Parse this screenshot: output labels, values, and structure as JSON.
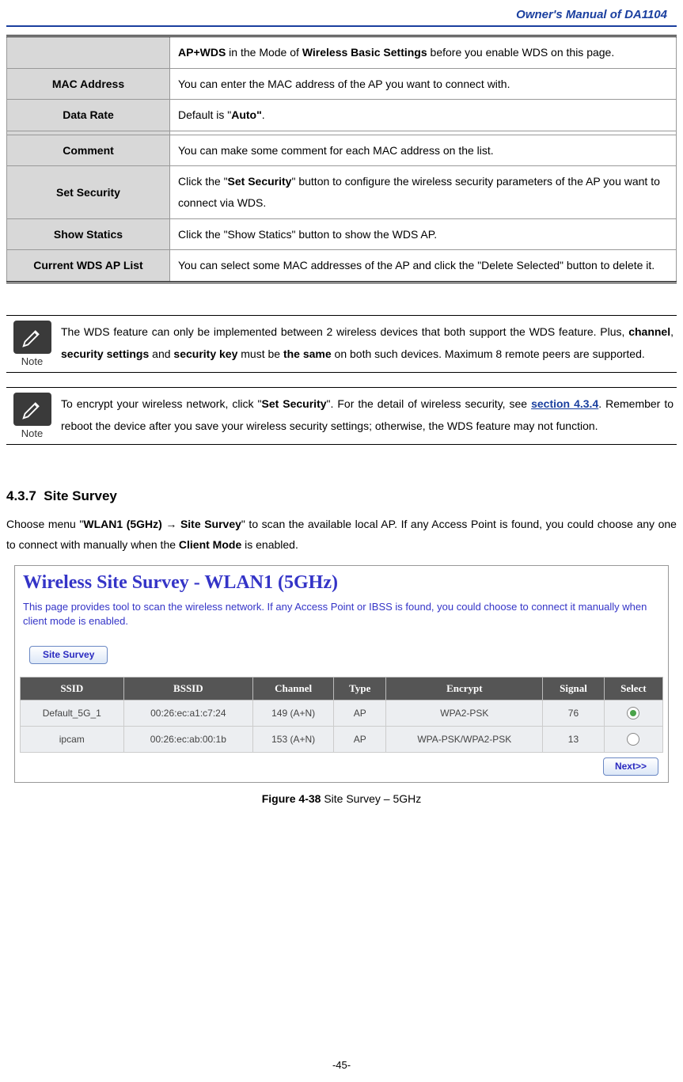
{
  "header": {
    "title": "Owner's Manual of DA1104"
  },
  "params": {
    "rows": [
      {
        "label": "",
        "html": "<b>AP+WDS</b> in the Mode of <b>Wireless Basic Settings</b> before you enable WDS on this page."
      },
      {
        "label": "MAC Address",
        "html": "You can enter the MAC address of the AP you want to connect with."
      },
      {
        "label": "Data Rate",
        "html": "Default is \"<b>Auto\"</b>."
      },
      {
        "label": "Comment",
        "html": "You can make some comment for each MAC address on the list."
      },
      {
        "label": "Set Security",
        "html": "Click the \"<b>Set Security</b>\" button to configure the wireless security parameters of the AP you want to connect via WDS."
      },
      {
        "label": "Show Statics",
        "html": "Click the \"Show Statics\" button to show the WDS AP."
      },
      {
        "label": "Current WDS AP List",
        "html": "You can select some MAC addresses of the AP and click the \"Delete Selected\" button to delete it."
      }
    ]
  },
  "note": {
    "label": "Note",
    "n1": "The WDS feature can only be implemented between 2 wireless devices that both support the WDS feature. Plus, <b>channel</b>, <b>security settings</b> and <b>security key</b> must be <b>the same</b> on both such devices. Maximum 8 remote peers are supported.",
    "n2": "To encrypt your wireless network, click \"<b>Set Security</b>\". For the detail of wireless security, see <span class='link-s'>section 4.3.4</span>. Remember to reboot the device after you save your wireless security settings; otherwise, the WDS feature may not function."
  },
  "section": {
    "num": "4.3.7",
    "title": "Site Survey",
    "body": "Choose menu \"<b>WLAN1 (5GHz) → Site Survey</b>\" to scan the available local AP. If any Access Point is found, you could choose any one to connect with manually when the <b>Client Mode</b> is enabled."
  },
  "screenshot": {
    "title": "Wireless Site Survey - WLAN1 (5GHz)",
    "desc": "This page provides tool to scan the wireless network. If any Access Point or IBSS is found, you could choose to connect it manually when client mode is enabled.",
    "btn": "Site Survey",
    "next": "Next>>",
    "cols": [
      "SSID",
      "BSSID",
      "Channel",
      "Type",
      "Encrypt",
      "Signal",
      "Select"
    ],
    "rows": [
      {
        "ssid": "Default_5G_1",
        "bssid": "00:26:ec:a1:c7:24",
        "channel": "149 (A+N)",
        "type": "AP",
        "encrypt": "WPA2-PSK",
        "signal": "76",
        "selected": true
      },
      {
        "ssid": "ipcam",
        "bssid": "00:26:ec:ab:00:1b",
        "channel": "153 (A+N)",
        "type": "AP",
        "encrypt": "WPA-PSK/WPA2-PSK",
        "signal": "13",
        "selected": false
      }
    ]
  },
  "figure": {
    "label": "Figure 4-38",
    "caption": "Site Survey – 5GHz"
  },
  "footer": {
    "page": "-45-"
  }
}
